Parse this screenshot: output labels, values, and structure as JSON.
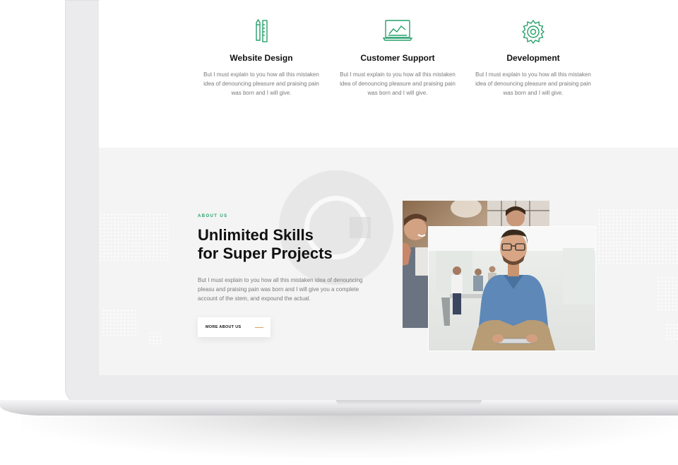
{
  "services": [
    {
      "icon": "ruler-pencil-icon",
      "title": "Website Design",
      "text": "But I must explain to you how all this mistaken idea of denouncing pleasure and praising pain was born and I will give."
    },
    {
      "icon": "laptop-chart-icon",
      "title": "Customer Support",
      "text": "But I must explain to you how all this mistaken idea of denouncing pleasure and praising pain was born and I will give."
    },
    {
      "icon": "gear-icon",
      "title": "Development",
      "text": "But I must explain to you how all this mistaken idea of denouncing pleasure and praising pain was born and I will give."
    }
  ],
  "about": {
    "eyebrow": "ABOUT US",
    "headline_line1": "Unlimited Skills",
    "headline_line2": "for Super Projects",
    "body": "But I must explain to you how all this mistaken idea of denouncing pleasu and praising pain was born and I will give you a complete account of the stem, and expound the actual.",
    "button_label": "MORE ABOUT US"
  },
  "colors": {
    "accent_green": "#27a06a",
    "button_line": "#e0a060",
    "section_bg": "#f4f4f4"
  }
}
